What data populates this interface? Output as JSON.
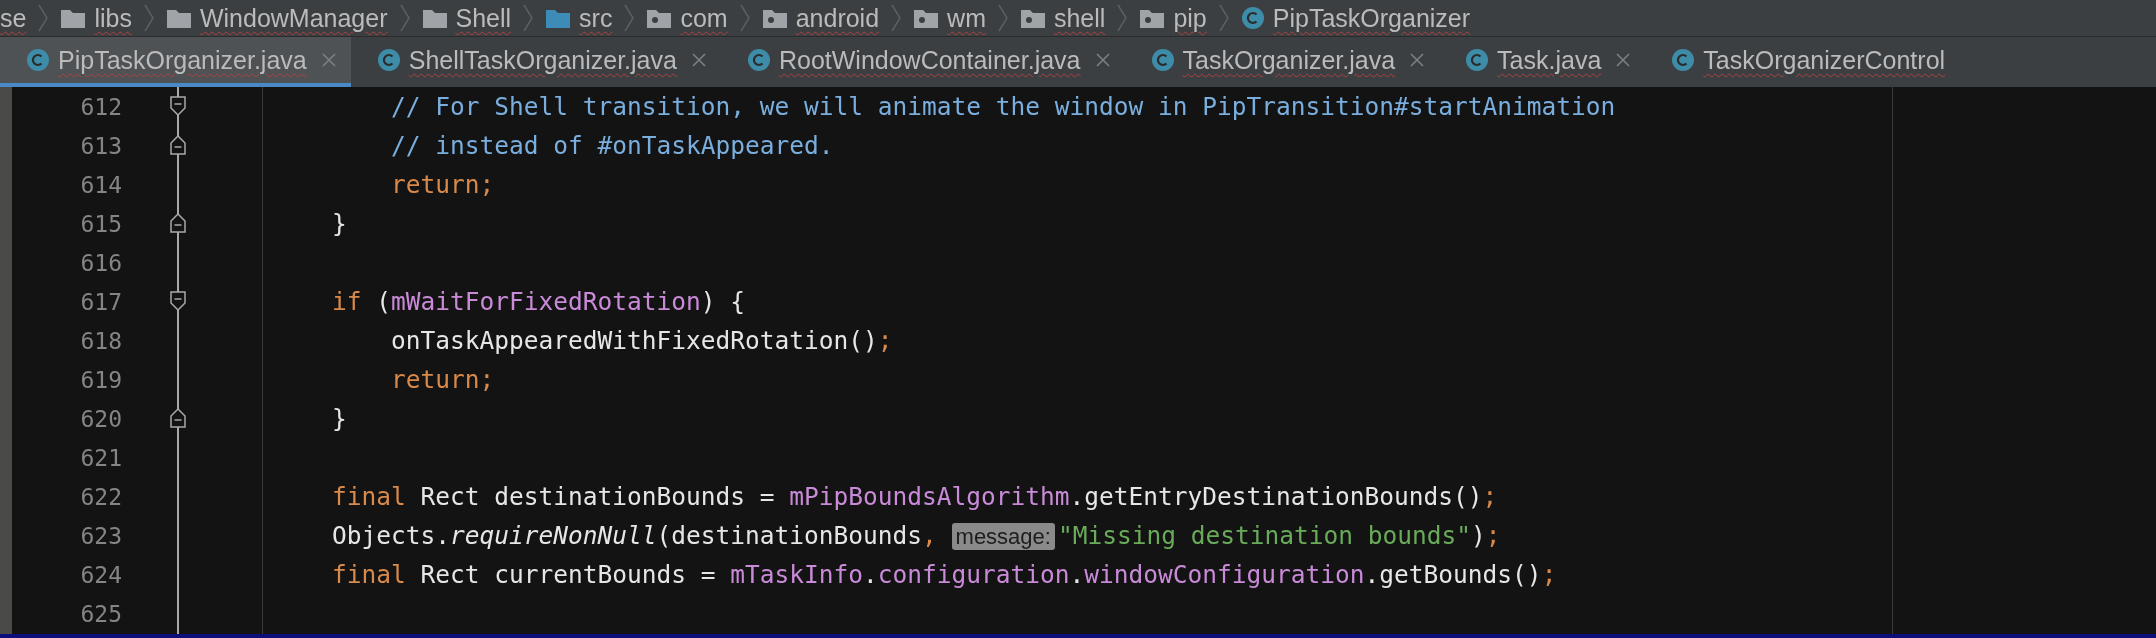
{
  "breadcrumb": [
    {
      "label": "se",
      "kind": "none"
    },
    {
      "label": "libs",
      "kind": "folder"
    },
    {
      "label": "WindowManager",
      "kind": "folder"
    },
    {
      "label": "Shell",
      "kind": "folder"
    },
    {
      "label": "src",
      "kind": "source"
    },
    {
      "label": "com",
      "kind": "package"
    },
    {
      "label": "android",
      "kind": "package"
    },
    {
      "label": "wm",
      "kind": "package"
    },
    {
      "label": "shell",
      "kind": "package"
    },
    {
      "label": "pip",
      "kind": "package"
    },
    {
      "label": "PipTaskOrganizer",
      "kind": "class"
    }
  ],
  "tabs": [
    {
      "label": "PipTaskOrganizer.java",
      "selected": true,
      "closable": true
    },
    {
      "label": "ShellTaskOrganizer.java",
      "selected": false,
      "closable": true
    },
    {
      "label": "RootWindowContainer.java",
      "selected": false,
      "closable": true
    },
    {
      "label": "TaskOrganizer.java",
      "selected": false,
      "closable": true
    },
    {
      "label": "Task.java",
      "selected": false,
      "closable": true
    },
    {
      "label": "TaskOrganizerControl",
      "selected": false,
      "closable": false
    }
  ],
  "code": [
    {
      "number": "612",
      "fold_start": true,
      "fold_end": false,
      "tokens": [
        {
          "kind": "comment",
          "text": "        // For Shell transition, we will animate the window in PipTransition#startAnimation"
        }
      ]
    },
    {
      "number": "613",
      "fold_start": false,
      "fold_end": true,
      "tokens": [
        {
          "kind": "comment",
          "text": "        // instead of #onTaskAppeared."
        }
      ]
    },
    {
      "number": "614",
      "fold_start": false,
      "fold_end": false,
      "tokens": [
        {
          "kind": "keyword",
          "text": "        return;"
        }
      ]
    },
    {
      "number": "615",
      "fold_start": false,
      "fold_end": true,
      "tokens": [
        {
          "kind": "plain",
          "text": "    }"
        }
      ]
    },
    {
      "number": "616",
      "fold_start": false,
      "fold_end": false
    },
    {
      "number": "617",
      "fold_start": true,
      "fold_end": false,
      "tokens": [
        {
          "kind": "keyword",
          "text": "    if "
        },
        {
          "kind": "plain",
          "text": "("
        },
        {
          "kind": "field",
          "text": "mWaitForFixedRotation"
        },
        {
          "kind": "plain",
          "text": ") {"
        }
      ]
    },
    {
      "number": "618",
      "fold_start": false,
      "fold_end": false,
      "tokens": [
        {
          "kind": "plain",
          "text": "        onTaskAppearedWithFixedRotation()"
        },
        {
          "kind": "keyword",
          "text": ";"
        }
      ]
    },
    {
      "number": "619",
      "fold_start": false,
      "fold_end": false,
      "tokens": [
        {
          "kind": "keyword",
          "text": "        return;"
        }
      ]
    },
    {
      "number": "620",
      "fold_start": false,
      "fold_end": true,
      "tokens": [
        {
          "kind": "plain",
          "text": "    }"
        }
      ]
    },
    {
      "number": "621",
      "fold_start": false,
      "fold_end": false
    },
    {
      "number": "622",
      "fold_start": false,
      "fold_end": false,
      "tokens": [
        {
          "kind": "keyword",
          "text": "    final "
        },
        {
          "kind": "plain",
          "text": "Rect destinationBounds = "
        },
        {
          "kind": "field",
          "text": "mPipBoundsAlgorithm"
        },
        {
          "kind": "plain",
          "text": ".getEntryDestinationBounds()"
        },
        {
          "kind": "keyword",
          "text": ";"
        }
      ]
    },
    {
      "number": "623",
      "fold_start": false,
      "fold_end": false,
      "tokens": [
        {
          "kind": "plain",
          "text": "    Objects."
        },
        {
          "kind": "italic",
          "text": "requireNonNull"
        },
        {
          "kind": "plain",
          "text": "(destinationBounds"
        },
        {
          "kind": "keyword",
          "text": ", "
        },
        {
          "kind": "hint",
          "text": "message:"
        },
        {
          "kind": "string",
          "text": "\"Missing destination bounds\""
        },
        {
          "kind": "plain",
          "text": ")"
        },
        {
          "kind": "keyword",
          "text": ";"
        }
      ]
    },
    {
      "number": "624",
      "fold_start": false,
      "fold_end": false,
      "tokens": [
        {
          "kind": "keyword",
          "text": "    final "
        },
        {
          "kind": "plain",
          "text": "Rect currentBounds = "
        },
        {
          "kind": "field",
          "text": "mTaskInfo"
        },
        {
          "kind": "plain",
          "text": "."
        },
        {
          "kind": "field",
          "text": "configuration"
        },
        {
          "kind": "plain",
          "text": "."
        },
        {
          "kind": "field",
          "text": "windowConfiguration"
        },
        {
          "kind": "plain",
          "text": ".getBounds()"
        },
        {
          "kind": "keyword",
          "text": ";"
        }
      ]
    },
    {
      "number": "625",
      "fold_start": false,
      "fold_end": false
    }
  ]
}
